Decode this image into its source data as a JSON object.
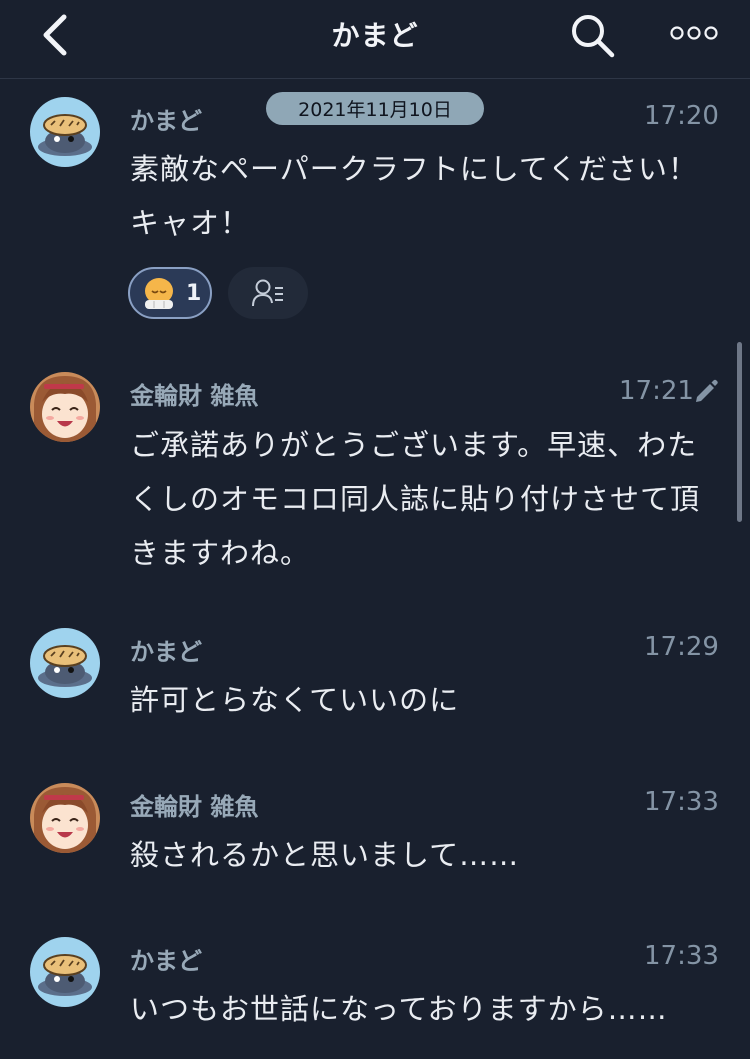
{
  "header": {
    "title": "かまど"
  },
  "date_divider": "2021年11月10日",
  "messages": [
    {
      "author": "かまど",
      "time": "17:20",
      "text": "素敵なペーパークラフトにしてください！キャオ！",
      "reaction_count": "1"
    },
    {
      "author": "金輪財 雑魚",
      "time": "17:21",
      "text": "ご承諾ありがとうございます。早速、わたくしのオモコロ同人誌に貼り付けさせて頂きますわね。"
    },
    {
      "author": "かまど",
      "time": "17:29",
      "text": "許可とらなくていいのに"
    },
    {
      "author": "金輪財 雑魚",
      "time": "17:33",
      "text": "殺されるかと思いまして……"
    },
    {
      "author": "かまど",
      "time": "17:33",
      "text": "いつもお世話になっておりますから……"
    }
  ],
  "icons": {
    "back": "chevron-left-icon",
    "search": "search-icon",
    "more": "more-dots-icon",
    "edited": "pencil-icon",
    "reaction_add": "reaction-add-icon"
  },
  "colors": {
    "background": "#19202e",
    "author": "#98a9b8",
    "time": "#8494a5",
    "date_pill": "#8fa7b6",
    "reaction_bg": "#2b3a57"
  }
}
